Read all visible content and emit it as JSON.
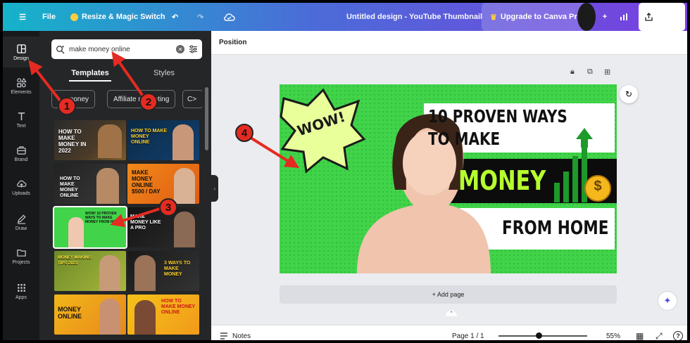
{
  "topbar": {
    "file_label": "File",
    "resize_label": "Resize & Magic Switch",
    "design_title": "Untitled design - YouTube Thumbnail",
    "upgrade_label": "Upgrade to Canva Pro",
    "share_label": "Share"
  },
  "rail": {
    "items": [
      {
        "label": "Design",
        "icon": "layout-icon"
      },
      {
        "label": "Elements",
        "icon": "shapes-icon"
      },
      {
        "label": "Text",
        "icon": "text-icon"
      },
      {
        "label": "Brand",
        "icon": "brand-icon"
      },
      {
        "label": "Uploads",
        "icon": "cloud-upload-icon"
      },
      {
        "label": "Draw",
        "icon": "pen-icon"
      },
      {
        "label": "Projects",
        "icon": "folder-icon"
      },
      {
        "label": "Apps",
        "icon": "apps-grid-icon"
      }
    ]
  },
  "panel": {
    "search_value": "make money online",
    "tabs": [
      "Templates",
      "Styles"
    ],
    "chips": [
      "money",
      "Affiliate marketing",
      "C>"
    ],
    "templates": [
      {
        "text": "HOW TO MAKE MONEY IN 2022"
      },
      {
        "text": "HOW TO MAKE MONEY ONLINE"
      },
      {
        "text": "HOW TO MAKE MONEY ONLINE"
      },
      {
        "text": "MAKE MONEY ONLINE $500 / DAY"
      },
      {
        "text": "WOW! 10 PROVEN WAYS TO MAKE MONEY FROM HOME"
      },
      {
        "text": "MAKE MONEY LIKE A PRO"
      },
      {
        "text": "MONEY MAKING TIPS 2023"
      },
      {
        "text": "3 WAYS TO MAKE MONEY"
      },
      {
        "text": "MONEY ONLINE"
      },
      {
        "text": "HOW TO MAKE MONEY ONLINE"
      }
    ]
  },
  "canvas": {
    "position_label": "Position",
    "thumb": {
      "wow": "WOW!",
      "line1": "10 PROVEN WAYS",
      "line2": "TO MAKE",
      "money": "MONEY",
      "from_home": "FROM HOME",
      "dollar": "$"
    },
    "add_page_label": "+ Add page"
  },
  "bottombar": {
    "notes_label": "Notes",
    "page_label": "Page 1 / 1",
    "zoom_label": "55%",
    "zoom_level": 0.55
  },
  "annotations": [
    "1",
    "2",
    "3",
    "4"
  ],
  "colors": {
    "accent_red": "#e52b21",
    "thumb_green": "#41d44a",
    "money_yellow": "#b6ff2e",
    "topbar_start": "#15b3c9",
    "topbar_end": "#7a3fe0"
  }
}
